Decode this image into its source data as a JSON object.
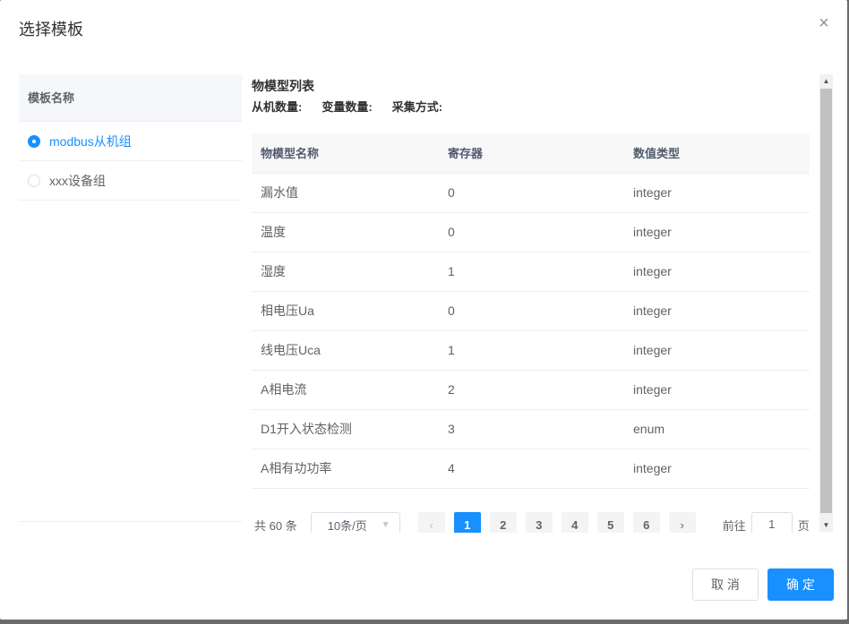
{
  "dialog": {
    "title": "选择模板",
    "close_icon": "close-icon"
  },
  "templates": {
    "header": "模板名称",
    "items": [
      {
        "label": "modbus从机组",
        "selected": true
      },
      {
        "label": "xxx设备组",
        "selected": false
      }
    ]
  },
  "model": {
    "title": "物模型列表",
    "slave_count_label": "从机数量:",
    "var_count_label": "变量数量:",
    "collect_mode_label": "采集方式:"
  },
  "table": {
    "columns": [
      "物模型名称",
      "寄存器",
      "数值类型"
    ],
    "rows": [
      [
        "漏水值",
        "0",
        "integer"
      ],
      [
        "温度",
        "0",
        "integer"
      ],
      [
        "湿度",
        "1",
        "integer"
      ],
      [
        "相电压Ua",
        "0",
        "integer"
      ],
      [
        "线电压Uca",
        "1",
        "integer"
      ],
      [
        "A相电流",
        "2",
        "integer"
      ],
      [
        "D1开入状态检测",
        "3",
        "enum"
      ],
      [
        "A相有功功率",
        "4",
        "integer"
      ]
    ]
  },
  "pagination": {
    "total": "共 60 条",
    "page_size": "10条/页",
    "pages": [
      "1",
      "2",
      "3",
      "4",
      "5",
      "6"
    ],
    "current": "1",
    "goto_label": "前往",
    "goto_value": "1",
    "page_unit": "页"
  },
  "footer": {
    "cancel": "取 消",
    "confirm": "确 定"
  },
  "colors": {
    "primary": "#1890ff"
  }
}
